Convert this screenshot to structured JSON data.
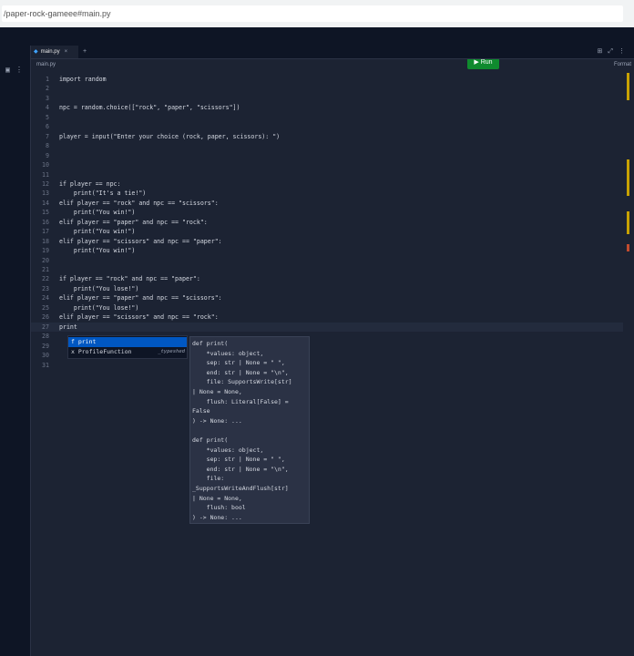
{
  "browser": {
    "url": "/paper-rock-gameee#main.py"
  },
  "header": {
    "run_label": "▶ Run"
  },
  "tabs": [
    {
      "label": "main.py",
      "close": "×"
    }
  ],
  "tab_add": "+",
  "breadcrumb": "main.py",
  "format_label": "Format",
  "code_lines": [
    {
      "n": "1",
      "t": "import random"
    },
    {
      "n": "2",
      "t": ""
    },
    {
      "n": "3",
      "t": ""
    },
    {
      "n": "4",
      "t": "npc = random.choice([\"rock\", \"paper\", \"scissors\"])"
    },
    {
      "n": "5",
      "t": ""
    },
    {
      "n": "6",
      "t": ""
    },
    {
      "n": "7",
      "t": "player = input(\"Enter your choice (rock, paper, scissors): \")"
    },
    {
      "n": "8",
      "t": ""
    },
    {
      "n": "9",
      "t": ""
    },
    {
      "n": "10",
      "t": ""
    },
    {
      "n": "11",
      "t": ""
    },
    {
      "n": "12",
      "t": "if player == npc:"
    },
    {
      "n": "13",
      "t": "    print(\"It's a tie!\")"
    },
    {
      "n": "14",
      "t": "elif player == \"rock\" and npc == \"scissors\":"
    },
    {
      "n": "15",
      "t": "    print(\"You win!\")"
    },
    {
      "n": "16",
      "t": "elif player == \"paper\" and npc == \"rock\":"
    },
    {
      "n": "17",
      "t": "    print(\"You win!\")"
    },
    {
      "n": "18",
      "t": "elif player == \"scissors\" and npc == \"paper\":"
    },
    {
      "n": "19",
      "t": "    print(\"You win!\")"
    },
    {
      "n": "20",
      "t": ""
    },
    {
      "n": "21",
      "t": ""
    },
    {
      "n": "22",
      "t": "if player == \"rock\" and npc == \"paper\":"
    },
    {
      "n": "23",
      "t": "    print(\"You lose!\")"
    },
    {
      "n": "24",
      "t": "elif player == \"paper\" and npc == \"scissors\":"
    },
    {
      "n": "25",
      "t": "    print(\"You lose!\")"
    },
    {
      "n": "26",
      "t": "elif player == \"scissors\" and npc == \"rock\":"
    },
    {
      "n": "27",
      "t": "print"
    },
    {
      "n": "28",
      "t": ""
    },
    {
      "n": "29",
      "t": ""
    },
    {
      "n": "30",
      "t": ""
    },
    {
      "n": "31",
      "t": ""
    }
  ],
  "autocomplete": {
    "items": [
      {
        "label": "f print",
        "hint": ""
      },
      {
        "label": "x ProfileFunction",
        "hint": "_typeshed"
      }
    ]
  },
  "signature_lines": [
    "def print(",
    "    *values: object,",
    "    sep: str | None = \" \",",
    "    end: str | None = \"\\n\",",
    "    file: SupportsWrite[str]",
    "| None = None,",
    "    flush: Literal[False] =",
    "False",
    ") -> None: ...",
    "",
    "def print(",
    "    *values: object,",
    "    sep: str | None = \" \",",
    "    end: str | None = \"\\n\",",
    "    file:",
    "_SupportsWriteAndFlush[str]",
    "| None = None,",
    "    flush: bool",
    ") -> None: ..."
  ]
}
